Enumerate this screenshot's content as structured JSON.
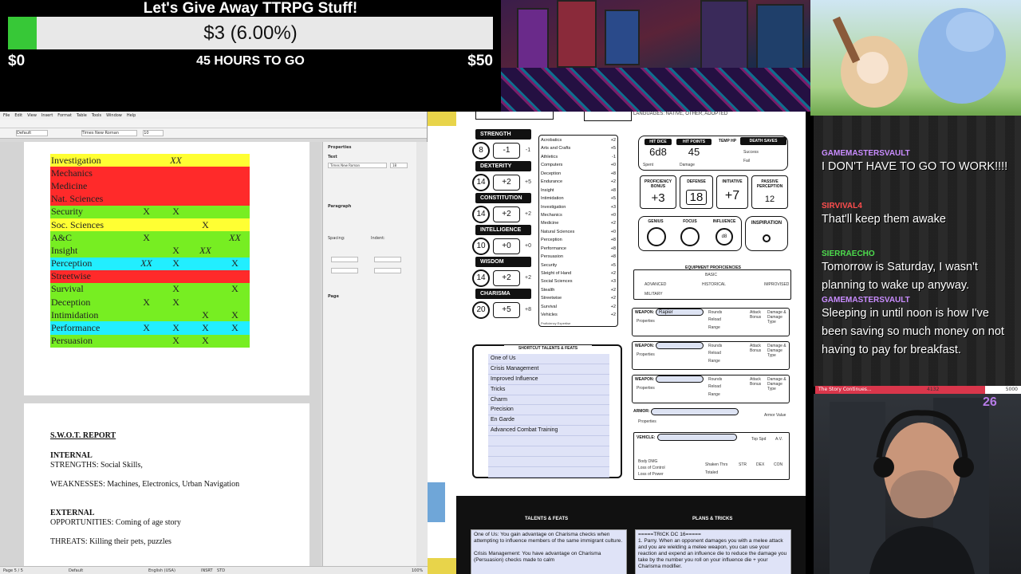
{
  "goal": {
    "title": "Let's Give Away TTRPG Stuff!",
    "amount": "$3 (6.00%)",
    "progress_pct": 6,
    "min": "$0",
    "max": "$50",
    "time_left": "45 HOURS TO GO"
  },
  "writer": {
    "menu": [
      "File",
      "Edit",
      "View",
      "Insert",
      "Format",
      "Table",
      "Tools",
      "Window",
      "Help"
    ],
    "find_placeholder": "Find",
    "style_value": "Default",
    "font_value": "Times New Roman",
    "size_value": "10",
    "skills_table": [
      {
        "name": "Investigation",
        "c1": "",
        "c2": "XX",
        "c3": "",
        "c4": "",
        "color": "#ffff33"
      },
      {
        "name": "Mechanics",
        "c1": "",
        "c2": "",
        "c3": "",
        "c4": "",
        "color": "#ff2a2a"
      },
      {
        "name": "Medicine",
        "c1": "",
        "c2": "",
        "c3": "",
        "c4": "",
        "color": "#ff2a2a"
      },
      {
        "name": "Nat. Sciences",
        "c1": "",
        "c2": "",
        "c3": "",
        "c4": "",
        "color": "#ff2a2a"
      },
      {
        "name": "Security",
        "c1": "X",
        "c2": "X",
        "c3": "",
        "c4": "",
        "color": "#77ee22"
      },
      {
        "name": "Soc. Sciences",
        "c1": "",
        "c2": "",
        "c3": "X",
        "c4": "",
        "color": "#ffff33"
      },
      {
        "name": "A&C",
        "c1": "X",
        "c2": "",
        "c3": "",
        "c4": "XX",
        "color": "#77ee22"
      },
      {
        "name": "Insight",
        "c1": "",
        "c2": "X",
        "c3": "XX",
        "c4": "",
        "color": "#77ee22"
      },
      {
        "name": "Perception",
        "c1": "XX",
        "c2": "X",
        "c3": "",
        "c4": "X",
        "color": "#22eeff"
      },
      {
        "name": "Streetwise",
        "c1": "",
        "c2": "",
        "c3": "",
        "c4": "",
        "color": "#ff2a2a"
      },
      {
        "name": "Survival",
        "c1": "",
        "c2": "X",
        "c3": "",
        "c4": "X",
        "color": "#77ee22"
      },
      {
        "name": "Deception",
        "c1": "X",
        "c2": "X",
        "c3": "",
        "c4": "",
        "color": "#77ee22"
      },
      {
        "name": "Intimidation",
        "c1": "",
        "c2": "",
        "c3": "X",
        "c4": "X",
        "color": "#77ee22"
      },
      {
        "name": "Performance",
        "c1": "X",
        "c2": "X",
        "c3": "X",
        "c4": "X",
        "color": "#22eeff"
      },
      {
        "name": "Persuasion",
        "c1": "",
        "c2": "X",
        "c3": "X",
        "c4": "",
        "color": "#77ee22"
      }
    ],
    "swot": {
      "title": "S.W.O.T. REPORT",
      "internal": "INTERNAL",
      "strengths": "STRENGTHS: Social Skills,",
      "weaknesses": "WEAKNESSES: Machines, Electronics, Urban Navigation",
      "external": "EXTERNAL",
      "opportunities": "OPPORTUNITIES: Coming of age story",
      "threats": "THREATS: Killing their pets, puzzles"
    },
    "sidebar": {
      "properties": "Properties",
      "text": "Text",
      "paragraph": "Paragraph",
      "spacing": "Spacing:",
      "indent": "Indent:",
      "page": "Page",
      "font": "Times New Roman",
      "size": "18"
    },
    "status": {
      "page": "Page 5 / 5",
      "style": "Default",
      "language": "English (USA)",
      "mode": "INSRT",
      "std": "STD",
      "zoom": "100%"
    }
  },
  "sheet": {
    "languages": "LANGUAGES: NATIVE, OTHER, ADOPTED",
    "abilities": [
      {
        "name": "STRENGTH",
        "score": "8",
        "mod": "-1",
        "save": "-1"
      },
      {
        "name": "DEXTERITY",
        "score": "14",
        "mod": "+2",
        "save": "+5"
      },
      {
        "name": "CONSTITUTION",
        "score": "14",
        "mod": "+2",
        "save": "+2"
      },
      {
        "name": "INTELLIGENCE",
        "score": "10",
        "mod": "+0",
        "save": "+0"
      },
      {
        "name": "WISDOM",
        "score": "14",
        "mod": "+2",
        "save": "+2"
      },
      {
        "name": "CHARISMA",
        "score": "20",
        "mod": "+5",
        "save": "+8"
      }
    ],
    "skills": [
      {
        "name": "Acrobatics",
        "val": "+2"
      },
      {
        "name": "Arts and Crafts",
        "val": "+5"
      },
      {
        "name": "Athletics",
        "val": "-1"
      },
      {
        "name": "Computers",
        "val": "+0"
      },
      {
        "name": "Deception",
        "val": "+8"
      },
      {
        "name": "Endurance",
        "val": "+2"
      },
      {
        "name": "Insight",
        "val": "+8"
      },
      {
        "name": "Intimidation",
        "val": "+5"
      },
      {
        "name": "Investigation",
        "val": "+3"
      },
      {
        "name": "Mechanics",
        "val": "+0"
      },
      {
        "name": "Medicine",
        "val": "+2"
      },
      {
        "name": "Natural Sciences",
        "val": "+0"
      },
      {
        "name": "Perception",
        "val": "+8"
      },
      {
        "name": "Performance",
        "val": "+8"
      },
      {
        "name": "Persuasion",
        "val": "+8"
      },
      {
        "name": "Security",
        "val": "+5"
      },
      {
        "name": "Sleight of Hand",
        "val": "+2"
      },
      {
        "name": "Social Sciences",
        "val": "+3"
      },
      {
        "name": "Stealth",
        "val": "+2"
      },
      {
        "name": "Streetwise",
        "val": "+2"
      },
      {
        "name": "Survival",
        "val": "+2"
      },
      {
        "name": "Vehicles",
        "val": "+2"
      }
    ],
    "skill_legend": "Proficiency    Expertise",
    "hit_dice_label": "HIT DICE",
    "hit_dice": "6d8",
    "hit_points_label": "HIT POINTS",
    "hit_points": "45",
    "temp_hp_label": "TEMP HP",
    "death_saves_label": "DEATH SAVES",
    "success": "Success",
    "fail": "Fail",
    "spent": "Spent",
    "damage": "Damage",
    "prof_bonus_label": "PROFICIENCY BONUS",
    "prof_bonus": "+3",
    "defense_label": "DEFENSE",
    "defense": "18",
    "initiative_label": "INITIATIVE",
    "initiative": "+7",
    "passive_label": "PASSIVE PERCEPTION",
    "passive": "12",
    "genius_label": "GENIUS",
    "focus_label": "FOCUS",
    "influence_label": "INFLUENCE",
    "influence_die": "d8",
    "inspiration_label": "INSPIRATION",
    "equip_prof_label": "EQUIPMENT PROFICIENCIES",
    "equip": [
      "BASIC",
      "ADVANCED",
      "HISTORICAL",
      "IMPROVISED",
      "MILITARY"
    ],
    "weapon_label": "WEAPON:",
    "weapon1": "Rapier",
    "properties": "Properties",
    "rounds": "Rounds",
    "reload": "Reload",
    "range": "Range",
    "attack_bonus": "Attack Bonus",
    "damage_type": "Damage & Damage Type",
    "armor_label": "ARMOR:",
    "armor_value": "Armor Value",
    "vehicle_label": "VEHICLE:",
    "top_spd": "Top Spd",
    "av": "A.V.",
    "body_dmg": "Body DMG",
    "loss_control": "Loss of Control",
    "loss_power": "Loss of Power",
    "shaken": "Shaken Thrs",
    "totaled": "Totaled",
    "str": "STR",
    "dex": "DEX",
    "con": "CON",
    "shortcut_title": "SHORTCUT TALENTS & FEATS",
    "talents": [
      "One of Us",
      "Crisis Management",
      "Improved Influence",
      "Tricks",
      "Charm",
      "Precision",
      "En Garde",
      "Advanced Combat Training",
      "",
      "",
      "",
      ""
    ],
    "talents_feats_head": "TALENTS & FEATS",
    "plans_tricks_head": "PLANS & TRICKS",
    "talents_text": "One of Us: You gain advantage on Charisma checks when attempting to influence members of the same immigrant culture.\n\nCrisis Management: You have advantage on Charisma (Persuasion) checks made to calm",
    "tricks_text": "=====TRICK DC 16=====\n1. Parry. When an opponent damages you with a melee attack and you are wielding a melee weapon, you can use your reaction and expend an influence die to reduce the damage you take by the number you roll on your influence die + your Charisma modifier."
  },
  "chat": {
    "messages": [
      {
        "user": "GAMEMASTERSVAULT",
        "user_color": "#c98cff",
        "text": "I DON'T HAVE TO GO TO WORK!!!!"
      },
      {
        "user": "SIRVIVAL4",
        "user_color": "#ff4d4d",
        "text": "That'll keep them awake"
      },
      {
        "user": "SIERRAECHO",
        "user_color": "#4ddc4d",
        "text": "Tomorrow is Saturday, I wasn't planning to wake up anyway."
      },
      {
        "user": "GAMEMASTERSVAULT",
        "user_color": "#c98cff",
        "text": "Sleeping in until noon is how I've been saving so much money on not having to pay for breakfast."
      }
    ]
  },
  "story": {
    "label": "The Story Continues...",
    "current": "4132",
    "max": "5000",
    "progress_pct": 82.6
  },
  "sub_count": "26",
  "colors": {
    "goal_fill": "#37c837",
    "story_fill": "#d9364b",
    "talent_panel": "#dfe3f7"
  }
}
